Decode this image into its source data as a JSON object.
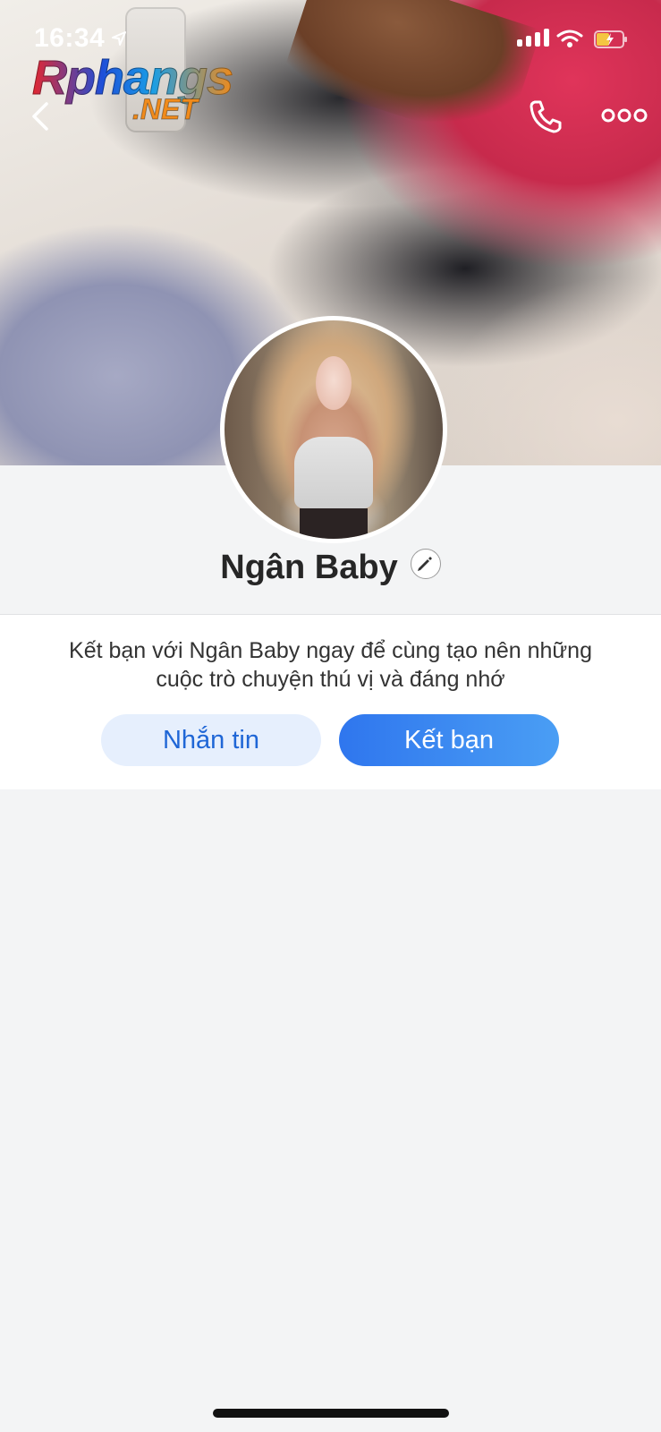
{
  "status_bar": {
    "time": "16:34"
  },
  "watermark": {
    "main": "Rphangs",
    "sub": ".NET"
  },
  "header": {
    "back_icon": "chevron-left-icon",
    "call_icon": "phone-icon",
    "more_icon": "more-horizontal-icon"
  },
  "profile": {
    "name": "Ngân Baby",
    "edit_icon": "pencil-icon"
  },
  "friend_card": {
    "invite_text_line1": "Kết bạn với Ngân Baby ngay để cùng tạo nên những",
    "invite_text_line2": "cuộc trò chuyện thú vị và đáng nhớ",
    "message_button": "Nhắn tin",
    "add_friend_button": "Kết bạn"
  },
  "colors": {
    "accent": "#2f76ee",
    "message_button_bg": "#e6effd",
    "page_bg": "#f3f4f5"
  }
}
